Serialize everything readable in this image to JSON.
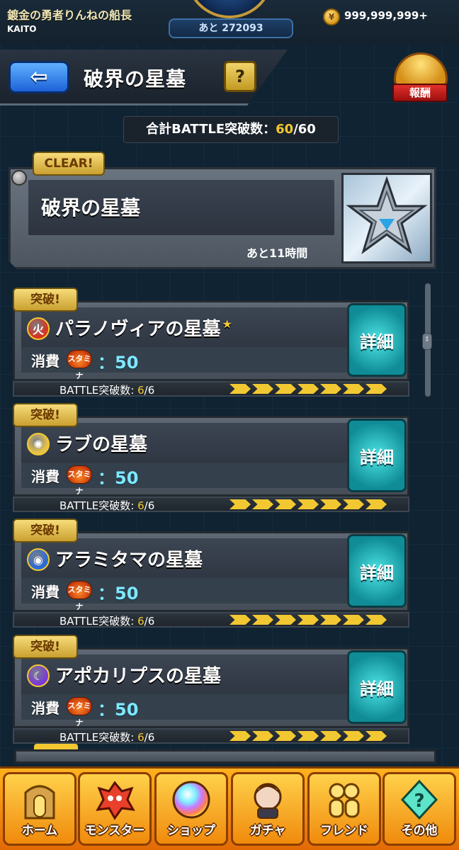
{
  "status": {
    "title": "鍍金の勇者りんねの船長",
    "user_name": "KAITO",
    "exp_remaining": "あと 272093",
    "coins": "999,999,999+"
  },
  "header": {
    "title": "破界の星墓",
    "help_label": "?",
    "reward_label": "報酬",
    "back_icon": "back-arrow-icon"
  },
  "total_battle": {
    "label": "合計BATTLE突破数：",
    "current": "60",
    "separator": "/",
    "max": "60"
  },
  "summary": {
    "badge": "CLEAR!",
    "name": "破界の星墓",
    "time_left": "あと11時間"
  },
  "quests": [
    {
      "badge": "突破!",
      "element": "fire",
      "element_color": "#d8321e",
      "name": "パラノヴィアの星墓",
      "star": "★",
      "cost_label": "消費",
      "stamina_label": "スタミナ",
      "cost_value": "：50",
      "battle_label": "BATTLE突破数: ",
      "battle_current": "6",
      "battle_max": "/6",
      "progress": 1.0,
      "detail_label": "詳細"
    },
    {
      "badge": "突破!",
      "element": "light",
      "element_color": "#e6c24a",
      "name": "ラブの星墓",
      "star": "",
      "cost_label": "消費",
      "stamina_label": "スタミナ",
      "cost_value": "：50",
      "battle_label": "BATTLE突破数: ",
      "battle_current": "6",
      "battle_max": "/6",
      "progress": 1.0,
      "detail_label": "詳細"
    },
    {
      "badge": "突破!",
      "element": "water",
      "element_color": "#2a6ad8",
      "name": "アラミタマの星墓",
      "star": "",
      "cost_label": "消費",
      "stamina_label": "スタミナ",
      "cost_value": "：50",
      "battle_label": "BATTLE突破数: ",
      "battle_current": "6",
      "battle_max": "/6",
      "progress": 1.0,
      "detail_label": "詳細"
    },
    {
      "badge": "突破!",
      "element": "dark",
      "element_color": "#7a3ad8",
      "name": "アポカリプスの星墓",
      "star": "",
      "cost_label": "消費",
      "stamina_label": "スタミナ",
      "cost_value": "：50",
      "battle_label": "BATTLE突破数: ",
      "battle_current": "6",
      "battle_max": "/6",
      "progress": 1.0,
      "detail_label": "詳細"
    }
  ],
  "nav": [
    {
      "label": "ホーム",
      "icon": "home-icon"
    },
    {
      "label": "モンスター",
      "icon": "monster-icon"
    },
    {
      "label": "ショップ",
      "icon": "shop-orb-icon"
    },
    {
      "label": "ガチャ",
      "icon": "gacha-icon"
    },
    {
      "label": "フレンド",
      "icon": "friend-icon"
    },
    {
      "label": "その他",
      "icon": "other-icon"
    }
  ],
  "colors": {
    "accent_yellow": "#f2c832",
    "detail_teal": "#1fb4bc",
    "nav_orange": "#f08a0c",
    "back_blue": "#1d62d8"
  }
}
